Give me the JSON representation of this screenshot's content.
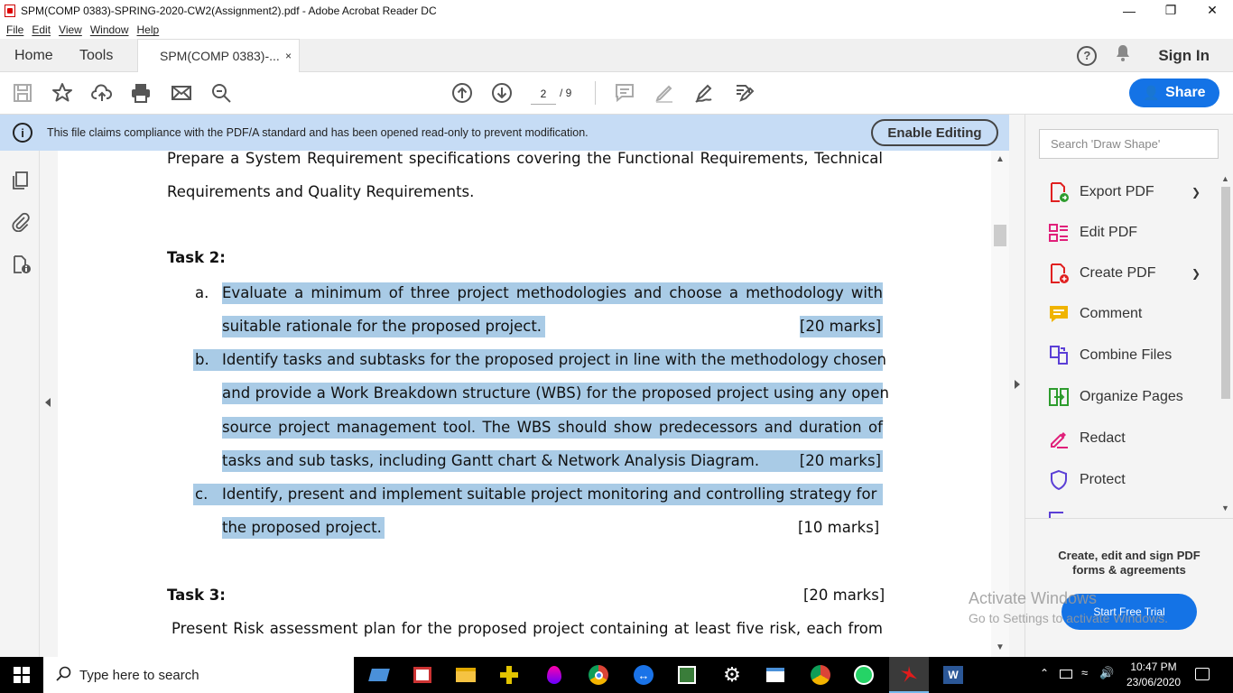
{
  "window": {
    "title": "SPM(COMP 0383)-SPRING-2020-CW2(Assignment2).pdf - Adobe Acrobat Reader DC"
  },
  "menu": [
    "File",
    "Edit",
    "View",
    "Window",
    "Help"
  ],
  "tabs": {
    "home": "Home",
    "tools": "Tools",
    "doc": "SPM(COMP 0383)-...",
    "close": "×"
  },
  "header": {
    "sign_in": "Sign In",
    "share": "Share"
  },
  "page_nav": {
    "current": "2",
    "total": "/ 9"
  },
  "infobar": {
    "message": "This file claims compliance with the PDF/A standard and has been opened read-only to prevent modification.",
    "enable_editing": "Enable Editing"
  },
  "document": {
    "intro_line1": [
      "Prepare",
      "a",
      "System",
      "Requirement",
      "specifications",
      "covering",
      "the",
      "Functional",
      "Requirements,",
      "Technical"
    ],
    "intro_line2": "Requirements and Quality Requirements.",
    "task2": {
      "heading": "Task 2:",
      "a_marker": "a.",
      "a_line1": [
        "Evaluate",
        "a",
        "minimum",
        "of",
        "three",
        "project",
        "methodologies",
        "and",
        "choose",
        "a",
        "methodology",
        "with"
      ],
      "a_line2": "suitable rationale for the proposed project.",
      "a_marks": "[20 marks]",
      "b_marker": "b.",
      "b_line1": "Identify tasks and subtasks for the proposed project in line with the methodology chosen",
      "b_line2": "and provide a Work Breakdown structure (WBS) for the proposed project using any open",
      "b_line3": [
        "source",
        "project",
        "management",
        "tool.",
        "The",
        "WBS",
        "should",
        "show",
        "predecessors",
        "and",
        "duration",
        "of"
      ],
      "b_line4": "tasks and sub tasks, including Gantt chart & Network Analysis Diagram.",
      "b_marks": "[20 marks]",
      "c_marker": "c.",
      "c_line1": "Identify, present and implement suitable project monitoring and controlling strategy for",
      "c_line2": "the proposed project.",
      "c_marks": "[10 marks]"
    },
    "task3": {
      "heading": "Task 3:",
      "marks": "[20 marks]",
      "line1": [
        "Present",
        "Risk",
        "assessment",
        "plan",
        "for",
        "the",
        "proposed",
        "project",
        "containing",
        "at",
        "least",
        "five",
        "risk,",
        "each",
        "from"
      ]
    }
  },
  "right_panel": {
    "search_placeholder": "Search 'Draw Shape'",
    "tools": [
      {
        "label": "Export PDF",
        "icon": "export-pdf-icon",
        "color": "#e02020"
      },
      {
        "label": "Edit PDF",
        "icon": "edit-pdf-icon",
        "color": "#e0207a"
      },
      {
        "label": "Create PDF",
        "icon": "create-pdf-icon",
        "color": "#e02020"
      },
      {
        "label": "Comment",
        "icon": "comment-icon",
        "color": "#f0b400"
      },
      {
        "label": "Combine Files",
        "icon": "combine-files-icon",
        "color": "#5b3fd6"
      },
      {
        "label": "Organize Pages",
        "icon": "organize-pages-icon",
        "color": "#2e9c2e"
      },
      {
        "label": "Redact",
        "icon": "redact-icon",
        "color": "#e0207a"
      },
      {
        "label": "Protect",
        "icon": "protect-icon",
        "color": "#5b3fd6"
      }
    ],
    "promo_line1": "Create, edit and sign PDF",
    "promo_line2": "forms & agreements",
    "trial": "Start Free Trial"
  },
  "watermark": {
    "line1": "Activate Windows",
    "line2": "Go to Settings to activate Windows."
  },
  "taskbar": {
    "search": "Type here to search",
    "time": "10:47 PM",
    "date": "23/06/2020"
  }
}
